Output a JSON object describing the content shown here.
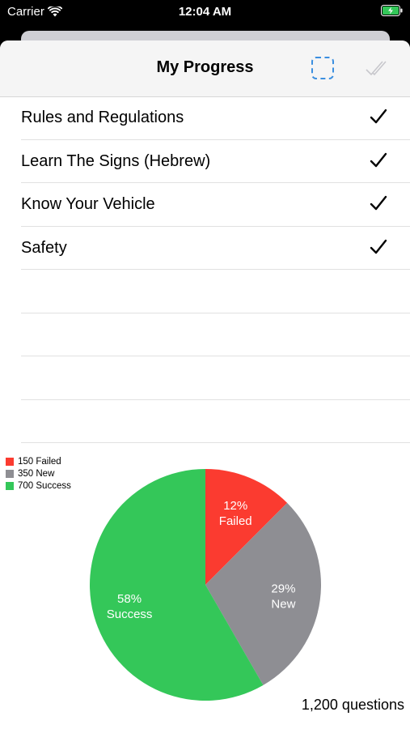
{
  "status_bar": {
    "carrier": "Carrier",
    "time": "12:04 AM"
  },
  "navbar": {
    "title": "My Progress",
    "select_icon": "dashed-square-icon",
    "check_all_icon": "double-check-icon"
  },
  "categories": [
    {
      "label": "Rules and Regulations",
      "checked": true
    },
    {
      "label": "Learn The Signs (Hebrew)",
      "checked": true
    },
    {
      "label": "Know Your Vehicle",
      "checked": true
    },
    {
      "label": "Safety",
      "checked": true
    },
    {
      "label": "",
      "checked": false
    },
    {
      "label": "",
      "checked": false
    },
    {
      "label": "",
      "checked": false
    },
    {
      "label": "",
      "checked": false
    }
  ],
  "legend": [
    {
      "label": "150 Failed",
      "color": "#fb3b30"
    },
    {
      "label": "350 New",
      "color": "#8e8e93"
    },
    {
      "label": "700 Success",
      "color": "#34c759"
    }
  ],
  "chart_data": {
    "type": "pie",
    "slices": [
      {
        "name": "Failed",
        "value": 150,
        "percent_label": "12%",
        "color": "#fb3b30"
      },
      {
        "name": "New",
        "value": 350,
        "percent_label": "29%",
        "color": "#8e8e93"
      },
      {
        "name": "Success",
        "value": 700,
        "percent_label": "58%",
        "color": "#34c759"
      }
    ],
    "total_label": "1,200 questions"
  }
}
